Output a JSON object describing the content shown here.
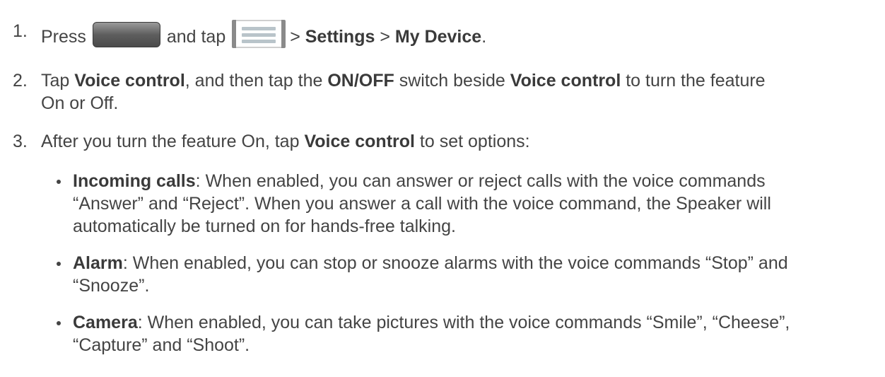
{
  "steps": [
    {
      "number": "1.",
      "press": "Press",
      "icon1": "home-key-icon",
      "and_tap": "and tap",
      "icon2": "menu-key-icon",
      "sep1": ">",
      "settings": "Settings",
      "sep2": ">",
      "my_device": "My Device",
      "end": "."
    },
    {
      "number": "2.",
      "tap": "Tap",
      "voice_control": "Voice control",
      "mid": ", and then tap the",
      "onoff": "ON/OFF",
      "switch_beside": "switch beside",
      "voice_control2": "Voice control",
      "to_turn": "to turn the feature",
      "line2": "On or Off."
    },
    {
      "number": "3.",
      "pre": "After you turn the feature On, tap",
      "voice_control": "Voice control",
      "post": "to set options:"
    }
  ],
  "bullets": [
    {
      "term": "Incoming calls",
      "line1": ": When enabled, you can answer or reject calls with the voice commands",
      "line2": "“Answer” and “Reject”. When you answer a call with the voice command, the Speaker will",
      "line3": "automatically be turned on for hands-free talking."
    },
    {
      "term": "Alarm",
      "line1": ": When enabled, you can stop or snooze alarms with the voice commands “Stop” and",
      "line2": "“Snooze”."
    },
    {
      "term": "Camera",
      "line1": ": When enabled, you can take pictures with the voice commands “Smile”, “Cheese”,",
      "line2": "“Capture” and “Shoot”."
    }
  ]
}
